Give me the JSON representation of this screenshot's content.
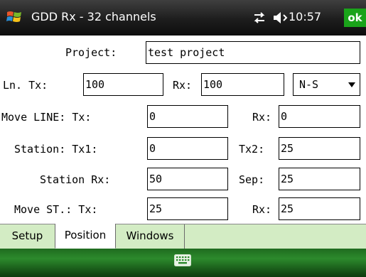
{
  "window": {
    "title": "GDD Rx - 32 channels",
    "clock": "10:57",
    "ok_label": "ok",
    "icons": {
      "start": "windows-flag-icon",
      "network": "network-sync-icon",
      "volume": "speaker-icon",
      "input": "keyboard-icon"
    },
    "colors": {
      "titlebar": "#1d1d1d",
      "ok": "#1aa31a",
      "softkey_bar": "#2c8a2c",
      "tab_bar": "#d3ecc4"
    }
  },
  "form": {
    "project": {
      "label": "Project:",
      "value": "test project"
    },
    "line": {
      "label": "Ln. Tx:",
      "tx_value": "100",
      "rx_label": "Rx:",
      "rx_value": "100",
      "direction": "N-S"
    },
    "move_line": {
      "label": "Move LINE: Tx:",
      "tx_value": "0",
      "rx_label": "Rx:",
      "rx_value": "0"
    },
    "station": {
      "label": "Station: Tx1:",
      "tx1_value": "0",
      "tx2_label": "Tx2:",
      "tx2_value": "25"
    },
    "station_rx": {
      "label": "Station Rx:",
      "value": "50",
      "sep_label": "Sep:",
      "sep_value": "25"
    },
    "move_st": {
      "label": "Move ST.: Tx:",
      "tx_value": "25",
      "rx_label": "Rx:",
      "rx_value": "25"
    }
  },
  "tabs": [
    {
      "label": "Setup"
    },
    {
      "label": "Position",
      "active": true
    },
    {
      "label": "Windows"
    }
  ]
}
